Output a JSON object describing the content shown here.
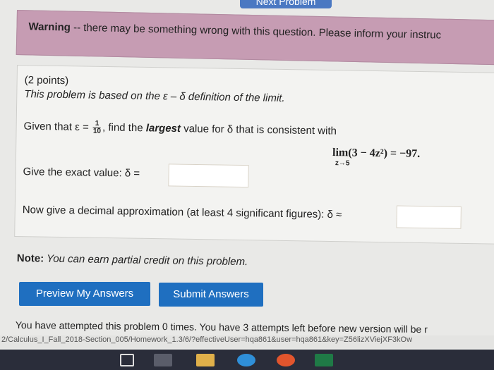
{
  "nav": {
    "next_problem": "Next Problem"
  },
  "warning": {
    "label": "Warning",
    "text": " -- there may be something wrong with this question. Please inform your instruc"
  },
  "problem": {
    "points": "(2 points)",
    "intro": "This problem is based on the ε – δ definition of the limit.",
    "given_prefix": "Given that ε = ",
    "epsilon_num": "1",
    "epsilon_den": "10",
    "given_mid": ", find the ",
    "given_bold": "largest",
    "given_suffix": " value for δ that is consistent with",
    "limit_word": "lim",
    "limit_sub": "z→5",
    "limit_expr": "(3 − 4z²) = −97.",
    "exact_prompt": "Give the exact value: δ =",
    "exact_value": "",
    "approx_prompt": "Now give a decimal approximation (at least 4 significant figures): δ ≈",
    "approx_value": ""
  },
  "note": {
    "label": "Note:",
    "text": " You can earn partial credit on this problem."
  },
  "buttons": {
    "preview": "Preview My Answers",
    "submit": "Submit Answers"
  },
  "attempts": "You have attempted this problem 0 times. You have 3 attempts left before new version will be r",
  "url": "2/Calculus_I_Fall_2018-Section_005/Homework_1.3/6/?effectiveUser=hqa861&user=hqa861&key=Z56lizXViejXF3kOw",
  "colors": {
    "warning_bg": "#c69cb3",
    "button_bg": "#1f6fc0",
    "taskbar": "#2a2d3a"
  }
}
